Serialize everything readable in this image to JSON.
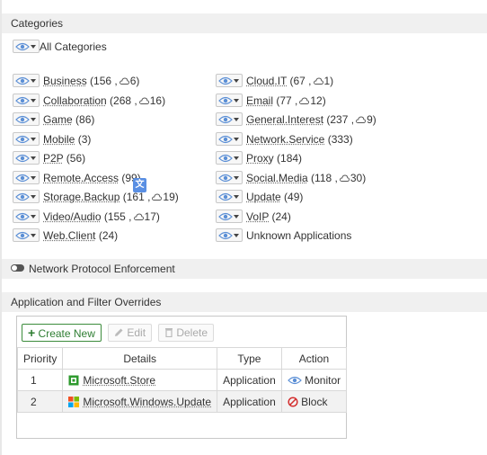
{
  "categories_section": {
    "title": "Categories",
    "all_label": "All Categories"
  },
  "categories": [
    {
      "name": "Business",
      "count": "(156 ,",
      "cloud": "6)"
    },
    {
      "name": "Cloud.IT",
      "count": "(67 ,",
      "cloud": "1)"
    },
    {
      "name": "Collaboration",
      "count": "(268 ,",
      "cloud": "16)"
    },
    {
      "name": "Email",
      "count": "(77 ,",
      "cloud": "12)"
    },
    {
      "name": "Game",
      "count": "(86)",
      "cloud": ""
    },
    {
      "name": "General.Interest",
      "count": "(237 ,",
      "cloud": "9)"
    },
    {
      "name": "Mobile",
      "count": "(3)",
      "cloud": ""
    },
    {
      "name": "Network.Service",
      "count": "(333)",
      "cloud": ""
    },
    {
      "name": "P2P",
      "count": "(56)",
      "cloud": ""
    },
    {
      "name": "Proxy",
      "count": "(184)",
      "cloud": ""
    },
    {
      "name": "Remote.Access",
      "count": "(99)",
      "cloud": ""
    },
    {
      "name": "Social.Media",
      "count": "(118 ,",
      "cloud": "30)"
    },
    {
      "name": "Storage.Backup",
      "count": "(161 ,",
      "cloud": "19)"
    },
    {
      "name": "Update",
      "count": "(49)",
      "cloud": ""
    },
    {
      "name": "Video/Audio",
      "count": "(155 ,",
      "cloud": "17)"
    },
    {
      "name": "VoIP",
      "count": "(24)",
      "cloud": ""
    },
    {
      "name": "Web.Client",
      "count": "(24)",
      "cloud": ""
    },
    {
      "name": "Unknown Applications",
      "count": "",
      "cloud": ""
    }
  ],
  "protocol": {
    "label": "Network Protocol Enforcement",
    "enabled": false
  },
  "overrides_section": {
    "title": "Application and Filter Overrides"
  },
  "toolbar": {
    "create": "Create New",
    "edit": "Edit",
    "delete": "Delete"
  },
  "table": {
    "headers": [
      "Priority",
      "Details",
      "Type",
      "Action"
    ],
    "rows": [
      {
        "priority": "1",
        "details": "Microsoft.Store",
        "type": "Application",
        "action": "Monitor"
      },
      {
        "priority": "2",
        "details": "Microsoft.Windows.Update",
        "type": "Application",
        "action": "Block"
      }
    ]
  },
  "colors": {
    "accent_green": "#2e7d32",
    "block_red": "#d32f2f",
    "monitor_blue": "#5b8fd6"
  }
}
